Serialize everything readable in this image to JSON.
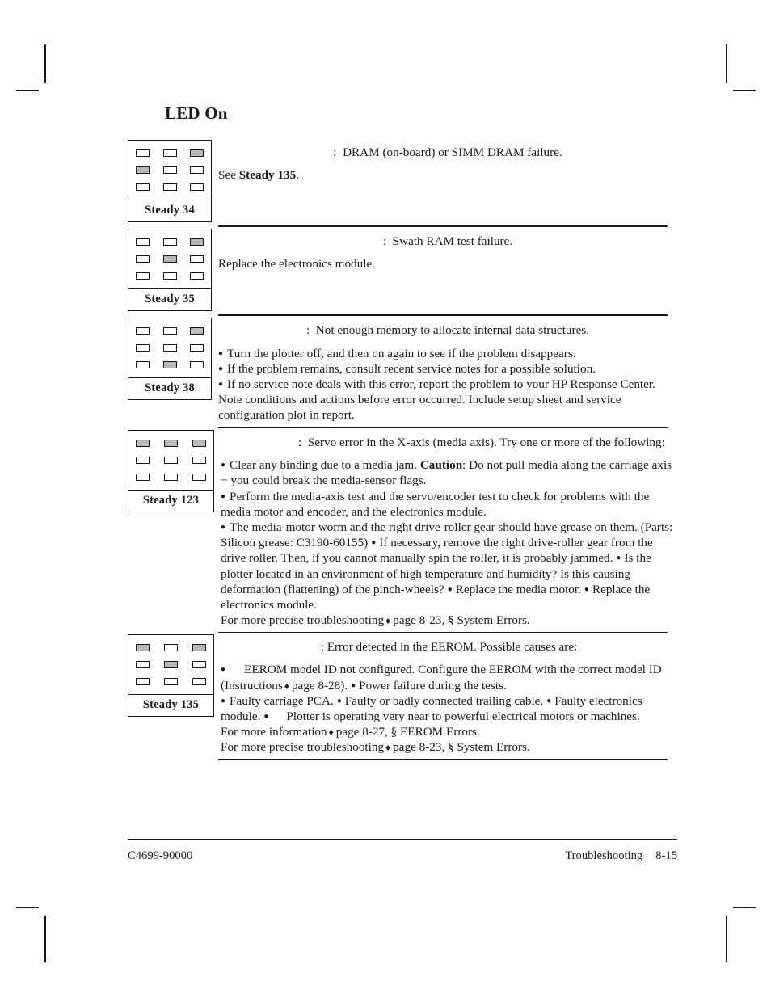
{
  "heading": "LED On",
  "footer": {
    "part_number": "C4699-90000",
    "chapter": "Troubleshooting",
    "page_number": "8-15"
  },
  "sections": [
    {
      "label": "Steady 34",
      "leds": [
        [
          false,
          false,
          true
        ],
        [
          true,
          false,
          false
        ],
        [
          false,
          false,
          false
        ]
      ],
      "headline": ":  DRAM (on-board) or SIMM DRAM failure.",
      "lines": [
        {
          "pre": "See ",
          "bold": "Steady 135",
          "post": "."
        }
      ]
    },
    {
      "label": "Steady 35",
      "leds": [
        [
          false,
          false,
          true
        ],
        [
          false,
          true,
          false
        ],
        [
          false,
          false,
          false
        ]
      ],
      "headline": ":  Swath RAM test failure.",
      "lines": [
        {
          "pre": "Replace the electronics module.",
          "bold": "",
          "post": ""
        }
      ]
    },
    {
      "label": "Steady 38",
      "leds": [
        [
          false,
          false,
          true
        ],
        [
          false,
          false,
          false
        ],
        [
          false,
          true,
          false
        ]
      ],
      "headline": ":  Not enough memory to allocate internal data structures.",
      "bullets": [
        "Turn the plotter off, and then on again to see if the problem disappears.",
        "If the problem remains, consult recent service notes for a possible solution.",
        "If no service note deals with this error, report the problem to your HP Response Center.  Note conditions and actions before error occurred.  Include setup sheet and service configuration plot in report."
      ]
    },
    {
      "label": "Steady 123",
      "leds": [
        [
          true,
          true,
          true
        ],
        [
          false,
          false,
          false
        ],
        [
          false,
          false,
          false
        ]
      ],
      "headline": ":  Servo error in the X-axis (media axis). Try one or more of the following:",
      "bullet1_pre": "Clear any binding due to a media jam.  ",
      "bullet1_bold": "Caution",
      "bullet1_post": ": Do not pull media along the carriage axis − you could break the media-sensor flags.",
      "bullet2": "Perform the media-axis test and the servo/encoder test to check for problems with the media motor and encoder, and the electronics module.",
      "bullet3a": "The media-motor worm and the right drive-roller gear should have grease on them. (Parts: Silicon grease: C3190-60155)",
      "bullet3b": "If necessary, remove the right drive-roller gear from the drive roller.  Then, if you cannot manually spin the roller, it is probably jammed.",
      "bullet3c": "Is the plotter located in an environment of high temperature and humidity?  Is this causing deformation (flattening) of the pinch-wheels?",
      "bullet3d": "Replace the media motor.",
      "bullet3e": "Replace the electronics module.",
      "ref1_pre": "For more precise troubleshooting",
      "ref1_post": "page 8-23, § System Errors."
    },
    {
      "label": "Steady 135",
      "leds": [
        [
          true,
          false,
          true
        ],
        [
          false,
          true,
          false
        ],
        [
          false,
          false,
          false
        ]
      ],
      "headline": ": Error detected in the EEROM. Possible causes are:",
      "cause1": "EEROM model ID not configured. Configure the EEROM with the correct model ID (Instructions",
      "cause1b": "page 8-28).",
      "cause2": "Power failure during the tests.",
      "cause3": "Faulty carriage PCA.",
      "cause4": "Faulty or badly connected trailing cable.",
      "cause5": "Faulty electronics module.",
      "cause6": "Plotter is operating very near to powerful electrical motors or machines.",
      "ref1_pre": "For more information",
      "ref1_post": "page 8-27,  § EEROM Errors.",
      "ref2_pre": "For more precise troubleshooting",
      "ref2_post": "page 8-23, § System Errors."
    }
  ]
}
